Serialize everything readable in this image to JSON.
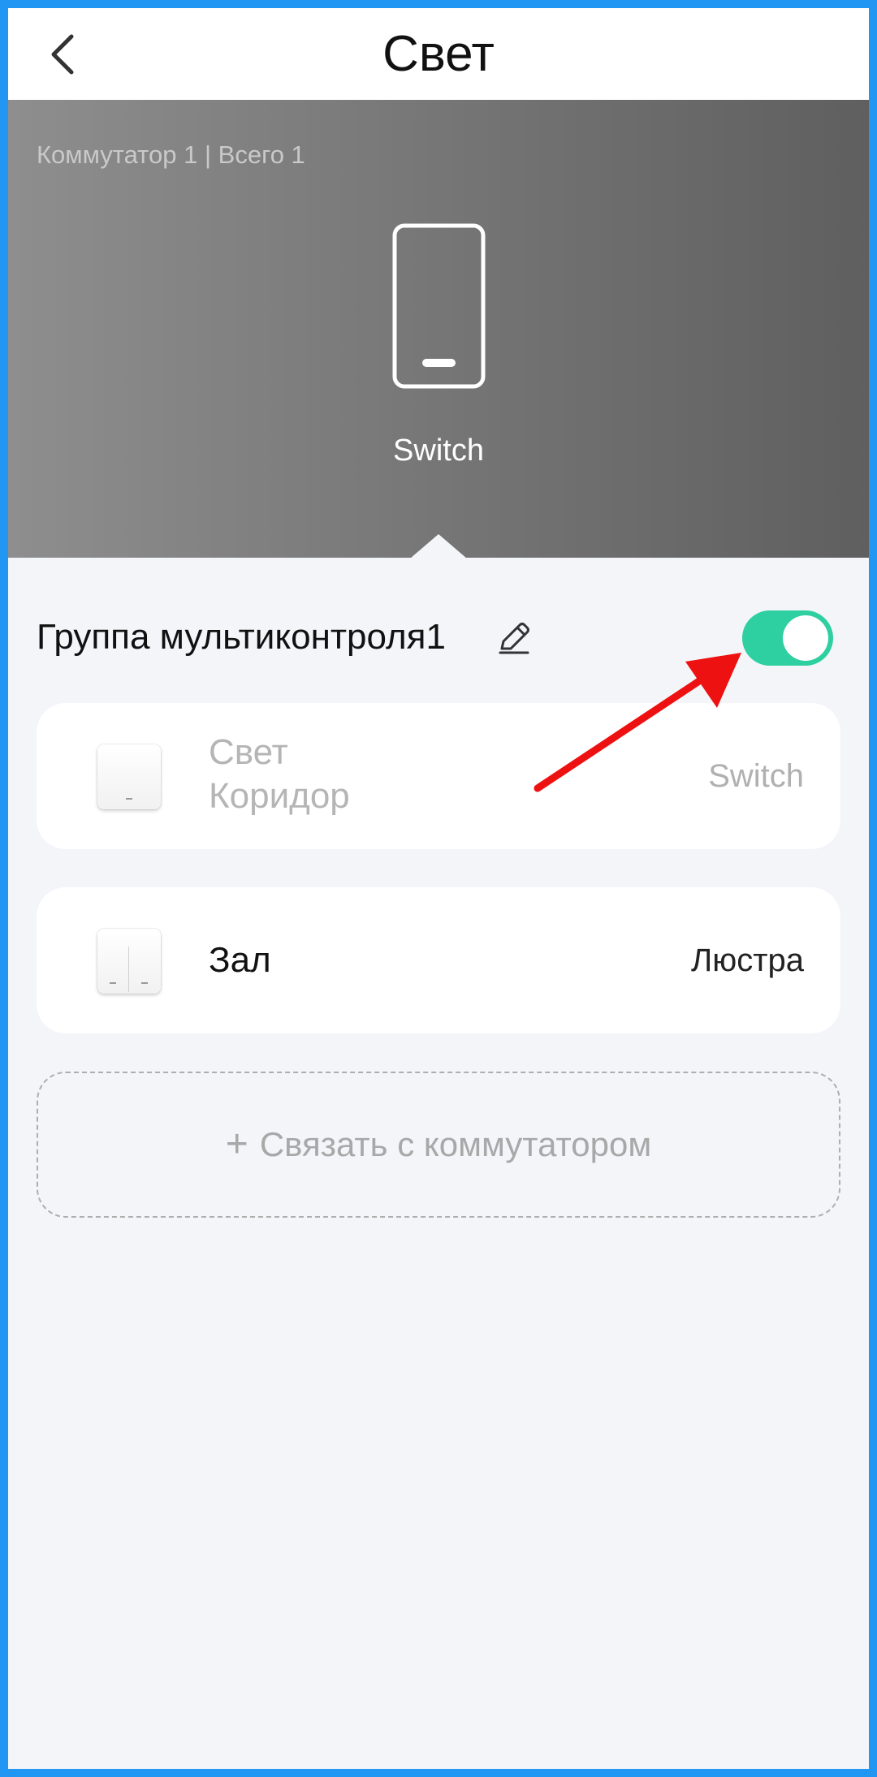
{
  "header": {
    "title": "Свет",
    "back_icon": "chevron-left-icon"
  },
  "hero": {
    "summary": "Коммутатор 1 | Всего 1",
    "device_label": "Switch",
    "device_icon": "wall-switch-icon",
    "gradient": [
      "#8E8E8E",
      "#5F5F5F"
    ]
  },
  "group": {
    "name": "Группа мультиконтроля1",
    "edit_icon": "pencil-icon",
    "toggle_on": true,
    "toggle_color": "#2ECFA0"
  },
  "devices": [
    {
      "name_line1": "Свет",
      "name_line2": "Коридор",
      "type": "Switch",
      "disabled": true,
      "icon": "single-gang-switch-icon"
    },
    {
      "name": "Зал",
      "type": "Люстра",
      "disabled": false,
      "icon": "double-gang-switch-icon"
    }
  ],
  "link_button": {
    "plus": "+",
    "label": "Связать с коммутатором"
  },
  "annotation": {
    "type": "red-arrow-icon",
    "color": "#EE1111"
  }
}
